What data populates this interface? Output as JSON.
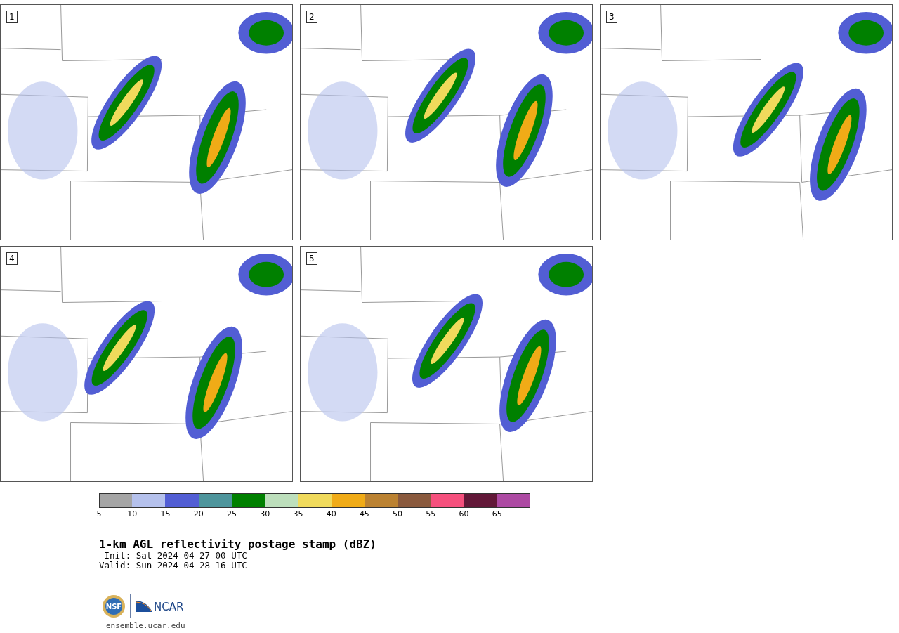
{
  "panels": [
    {
      "label": "1"
    },
    {
      "label": "2"
    },
    {
      "label": "3"
    },
    {
      "label": "4"
    },
    {
      "label": "5"
    }
  ],
  "colorbar": {
    "segments": [
      {
        "color": "#a5a5a5",
        "tick": "5"
      },
      {
        "color": "#b5c1ec",
        "tick": "10"
      },
      {
        "color": "#525ed4",
        "tick": "15"
      },
      {
        "color": "#4e959c",
        "tick": "20"
      },
      {
        "color": "#008000",
        "tick": "25"
      },
      {
        "color": "#bddfbc",
        "tick": "30"
      },
      {
        "color": "#f0da5c",
        "tick": "35"
      },
      {
        "color": "#f0ab17",
        "tick": "40"
      },
      {
        "color": "#bb8232",
        "tick": "45"
      },
      {
        "color": "#8a5a3e",
        "tick": "50"
      },
      {
        "color": "#f5507d",
        "tick": "55"
      },
      {
        "color": "#621838",
        "tick": "60"
      },
      {
        "color": "#ad4aa3",
        "tick": "65"
      }
    ]
  },
  "title": "1-km AGL reflectivity postage stamp (dBZ)",
  "init": " Init: Sat 2024-04-27 00 UTC",
  "valid": "Valid: Sun 2024-04-28 16 UTC",
  "logos": {
    "left": "NSF",
    "right": "NCAR"
  },
  "site": "ensemble.ucar.edu"
}
